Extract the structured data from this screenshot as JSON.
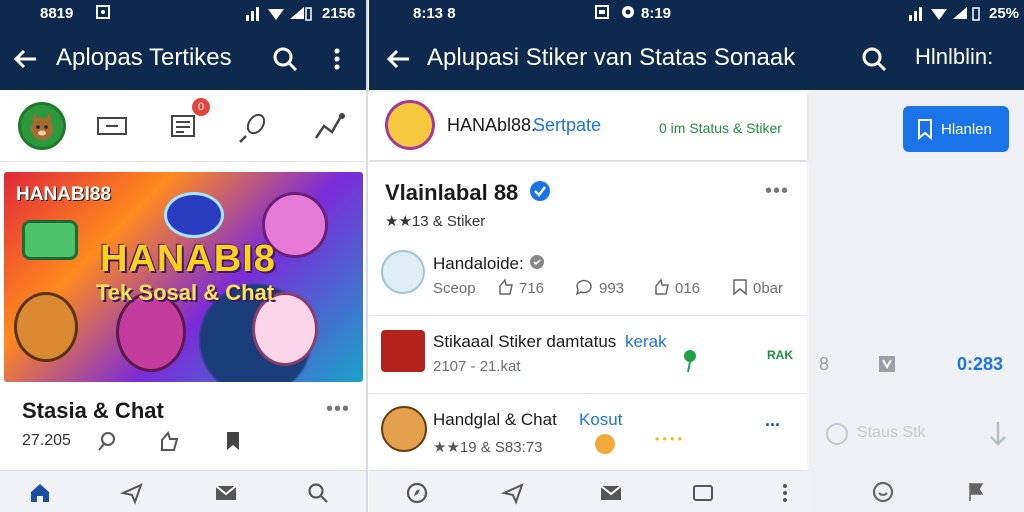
{
  "colors": {
    "appbar": "#0d2a4e",
    "accent": "#1a73e8",
    "green": "#2c9a3c",
    "badge": "#e2453b",
    "star": "#f4b400"
  },
  "left": {
    "status": {
      "time": "8819",
      "battery": "2156"
    },
    "appbar": {
      "title": "Aplopas Tertikes"
    },
    "icons": [
      "avatar-icon",
      "mail-icon",
      "chat-icon",
      "mic-icon",
      "share-icon"
    ],
    "notif_badge": "0",
    "banner": {
      "brand": "HANABI88",
      "headline": "HANABI8",
      "subline": "Tek Sosal & Chat"
    },
    "card": {
      "title": "Stasia & Chat",
      "meta": "27.205"
    }
  },
  "mid": {
    "status": {
      "time": "8:13 8",
      "time2": "8:19"
    },
    "appbar": {
      "title": "Aplupasi Stiker van Statas Sonaak"
    },
    "profile": {
      "name": "HANAbl88.",
      "link": "Sertpate",
      "tag": "0 im Status & Stiker"
    },
    "header": {
      "title": "Vlainlabal 88",
      "rating": "★★13 & Stiker"
    },
    "rows": [
      {
        "title": "Handaloide:",
        "meta": "Sceop",
        "c1": "716",
        "c2": "993",
        "c3": "016",
        "c4": "0bar"
      },
      {
        "title": "Stikaaal Stiker damtatus",
        "link": "kerak",
        "meta": "2107 - 21.kat",
        "tag": "RAK"
      },
      {
        "title": "Handglal & Chat",
        "link": "Kosut",
        "meta": "★★19 & S83:73",
        "menu": "..."
      }
    ]
  },
  "right": {
    "status": {
      "battery": "25%"
    },
    "appbar": {
      "title": "Hlnlblin:"
    },
    "button": "Hlanlen",
    "meta": {
      "n": "8",
      "time": "0:283",
      "status": "Staus Stk"
    }
  }
}
